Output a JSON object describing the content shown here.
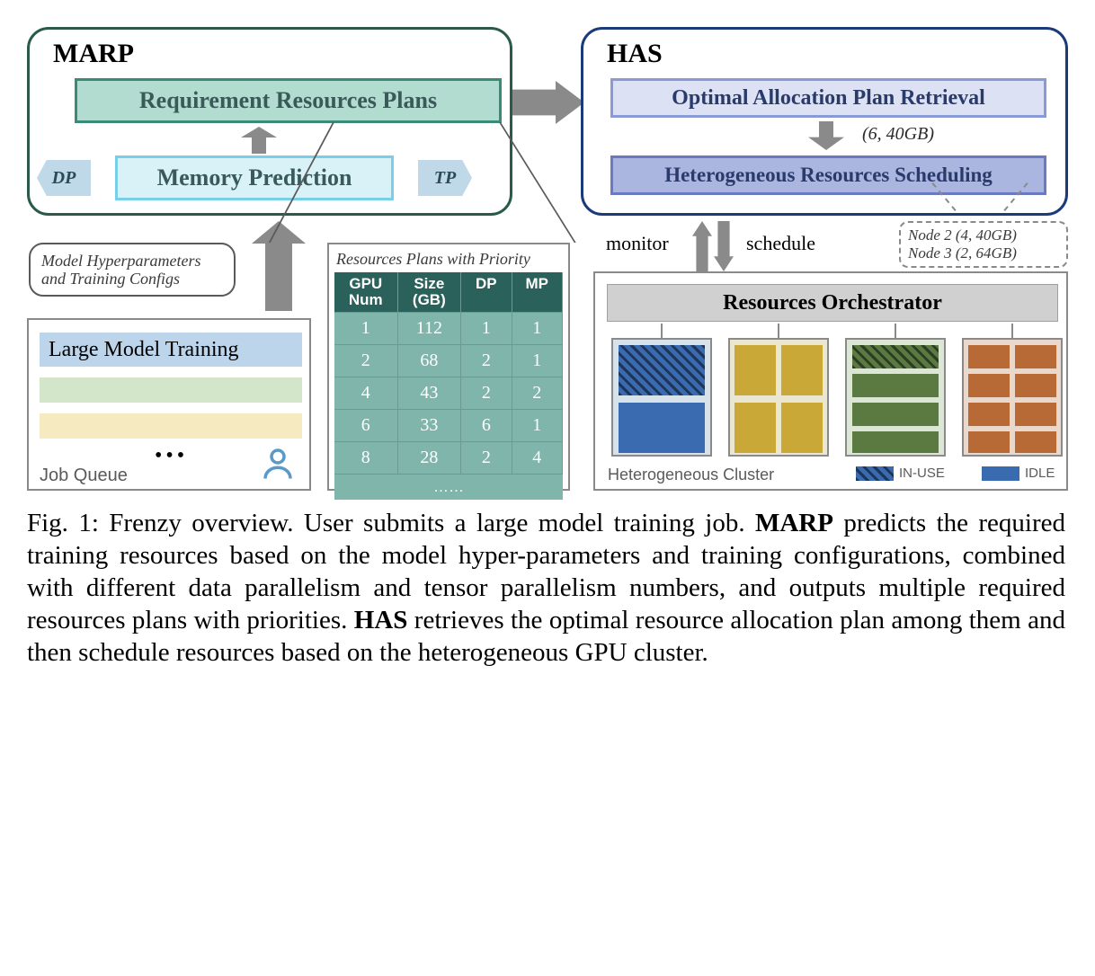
{
  "domain": "Diagram",
  "marp": {
    "title": "MARP",
    "req_plans": "Requirement Resources Plans",
    "mem_pred": "Memory Prediction",
    "dp": "DP",
    "tp": "TP"
  },
  "has": {
    "title": "HAS",
    "opt_alloc": "Optimal Allocation Plan Retrieval",
    "het_sched": "Heterogeneous Resources Scheduling",
    "alloc_tuple": "(6, 40GB)"
  },
  "hyper_callout": "Model Hyperparameters and Training Configs",
  "job_queue": {
    "top_bar": "Large Model Training",
    "dots": "•••",
    "label": "Job Queue"
  },
  "rp_table": {
    "title": "Resources Plans with Priority",
    "headers": {
      "c1": "GPU Num",
      "c2": "Size (GB)",
      "c3": "DP",
      "c4": "MP"
    },
    "rows": [
      {
        "gpu": "1",
        "size": "112",
        "dp": "1",
        "mp": "1"
      },
      {
        "gpu": "2",
        "size": "68",
        "dp": "2",
        "mp": "1"
      },
      {
        "gpu": "4",
        "size": "43",
        "dp": "2",
        "mp": "2"
      },
      {
        "gpu": "6",
        "size": "33",
        "dp": "6",
        "mp": "1"
      },
      {
        "gpu": "8",
        "size": "28",
        "dp": "2",
        "mp": "4"
      }
    ],
    "dots": "……"
  },
  "labels": {
    "monitor": "monitor",
    "schedule": "schedule"
  },
  "node_callout": {
    "l1": "Node 2 (4, 40GB)",
    "l2": "Node 3 (2, 64GB)"
  },
  "cluster": {
    "orch": "Resources  Orchestrator",
    "label": "Heterogeneous Cluster",
    "legend_inuse": "IN-USE",
    "legend_idle": "IDLE"
  },
  "caption": {
    "prefix": "Fig. 1: Frenzy overview. User submits a large model training job. ",
    "marp": "MARP",
    "mid1": " predicts the required training resources based on the model hyper-parameters and training configurations, combined with different data parallelism and tensor parallelism numbers, and outputs multiple required resources plans with priorities. ",
    "has": "HAS",
    "mid2": " retrieves the optimal resource allocation plan among them and then schedule resources based on the hetero­geneous GPU cluster."
  }
}
